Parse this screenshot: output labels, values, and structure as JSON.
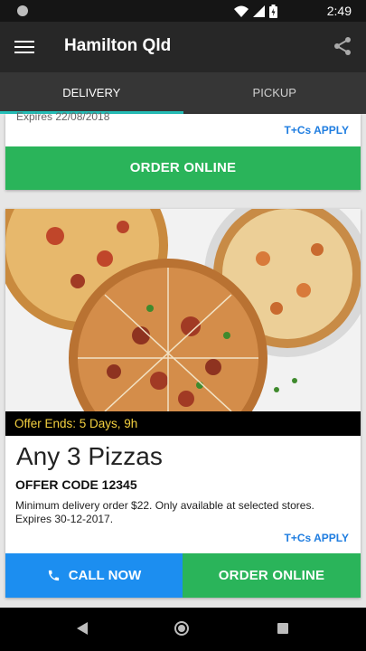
{
  "status_bar": {
    "time": "2:49"
  },
  "app_bar": {
    "title": "Hamilton Qld",
    "icons": [
      "menu-icon",
      "share-icon"
    ]
  },
  "tabs": [
    {
      "label": "DELIVERY",
      "active": true
    },
    {
      "label": "PICKUP",
      "active": false
    }
  ],
  "previous_offer": {
    "expires": "Expires 22/08/2018",
    "terms_label": "T+Cs APPLY",
    "order_label": "ORDER ONLINE"
  },
  "offer": {
    "ends_text": "Offer Ends: 5 Days, 9h",
    "title": "Any 3 Pizzas",
    "code": "OFFER CODE 12345",
    "description_lines": [
      "Minimum delivery order $22. Only available at selected stores.",
      "Expires 30-12-2017."
    ],
    "terms_label": "T+Cs APPLY",
    "call_label": "CALL NOW",
    "order_label": "ORDER ONLINE"
  },
  "colors": {
    "accent_teal": "#25c0b9",
    "order_green": "#2ab45a",
    "call_blue": "#1c8ef0",
    "offer_ends_yellow": "#f4d03f",
    "terms_blue": "#1f7de0"
  }
}
